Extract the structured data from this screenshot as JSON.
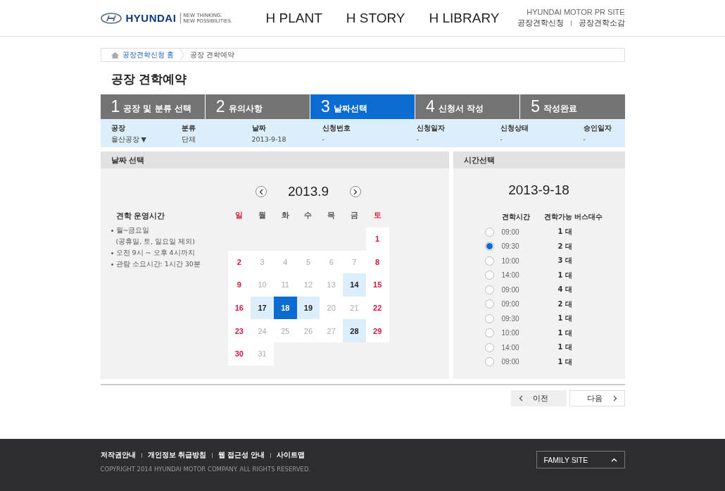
{
  "header": {
    "brand": "HYUNDAI",
    "tagline": [
      "NEW THINKING.",
      "NEW POSSIBILITIES."
    ],
    "nav": [
      "H PLANT",
      "H STORY",
      "H LIBRARY"
    ],
    "site_title": "HYUNDAI MOTOR PR SITE",
    "site_links": [
      "공장견학신청",
      "공장견학소감"
    ]
  },
  "breadcrumb": [
    "공장견학신청 홈",
    "공장 견학예약"
  ],
  "page_title": "공장 견학예약",
  "steps": [
    {
      "number": "1",
      "label": "공장 및 분류 선택",
      "selected": false
    },
    {
      "number": "2",
      "label": "유의사항",
      "selected": false
    },
    {
      "number": "3",
      "label": "날짜선택",
      "selected": true
    },
    {
      "number": "4",
      "label": "신청서 작성",
      "selected": false
    },
    {
      "number": "5",
      "label": "작성완료",
      "selected": false
    }
  ],
  "info": [
    {
      "label": "공장",
      "value": "울산공장 ▼"
    },
    {
      "label": "분류",
      "value": "단체"
    },
    {
      "label": "날짜",
      "value": "2013-9-18"
    },
    {
      "label": "신청번호",
      "value": "-"
    },
    {
      "label": "신청일자",
      "value": "-"
    },
    {
      "label": "신청상태",
      "value": "-"
    },
    {
      "label": "승인일자",
      "value": "-"
    }
  ],
  "date_panel": {
    "title": "날짜 선택",
    "month": "2013.9",
    "hours_title": "견학 운영시간",
    "hours_notes": [
      "월~금요일\n(공휴일, 토, 일요일 제외)",
      "오전 9시 ~ 오후 4시까지",
      "관람 소요시간: 1시간 30분"
    ],
    "weekdays": [
      {
        "label": "일",
        "kind": "weekend"
      },
      {
        "label": "월",
        "kind": "weekday"
      },
      {
        "label": "화",
        "kind": "weekday"
      },
      {
        "label": "수",
        "kind": "weekday"
      },
      {
        "label": "목",
        "kind": "weekday"
      },
      {
        "label": "금",
        "kind": "weekday"
      },
      {
        "label": "토",
        "kind": "weekend"
      }
    ],
    "weeks": [
      [
        {
          "day": "1",
          "kind": "weekend",
          "selected": false
        }
      ],
      [
        {
          "day": "2",
          "kind": "weekend",
          "selected": false
        },
        {
          "day": "3",
          "kind": "closed",
          "selected": false
        },
        {
          "day": "4",
          "kind": "closed",
          "selected": false
        },
        {
          "day": "5",
          "kind": "closed",
          "selected": false
        },
        {
          "day": "6",
          "kind": "closed",
          "selected": false
        },
        {
          "day": "7",
          "kind": "closed",
          "selected": false
        },
        {
          "day": "8",
          "kind": "weekend",
          "selected": false
        }
      ],
      [
        {
          "day": "9",
          "kind": "weekend",
          "selected": false
        },
        {
          "day": "10",
          "kind": "closed",
          "selected": false
        },
        {
          "day": "11",
          "kind": "closed",
          "selected": false
        },
        {
          "day": "12",
          "kind": "closed",
          "selected": false
        },
        {
          "day": "13",
          "kind": "closed",
          "selected": false
        },
        {
          "day": "14",
          "kind": "open",
          "selected": false
        },
        {
          "day": "15",
          "kind": "weekend",
          "selected": false
        }
      ],
      [
        {
          "day": "16",
          "kind": "weekend",
          "selected": false
        },
        {
          "day": "17",
          "kind": "open",
          "selected": false
        },
        {
          "day": "18",
          "kind": "open",
          "selected": true
        },
        {
          "day": "19",
          "kind": "open",
          "selected": false
        },
        {
          "day": "20",
          "kind": "closed",
          "selected": false
        },
        {
          "day": "21",
          "kind": "closed",
          "selected": false
        },
        {
          "day": "22",
          "kind": "weekend",
          "selected": false
        }
      ],
      [
        {
          "day": "23",
          "kind": "weekend",
          "selected": false
        },
        {
          "day": "24",
          "kind": "closed",
          "selected": false
        },
        {
          "day": "25",
          "kind": "closed",
          "selected": false
        },
        {
          "day": "26",
          "kind": "closed",
          "selected": false
        },
        {
          "day": "27",
          "kind": "closed",
          "selected": false
        },
        {
          "day": "28",
          "kind": "open",
          "selected": false
        },
        {
          "day": "29",
          "kind": "weekend",
          "selected": false
        }
      ],
      [
        {
          "day": "30",
          "kind": "weekend",
          "selected": false
        },
        {
          "day": "31",
          "kind": "closed",
          "selected": false
        }
      ]
    ]
  },
  "time_panel": {
    "title": "시간선택",
    "date": "2013-9-18",
    "columns": [
      "견학시간",
      "견학가능 버스대수"
    ],
    "slots": [
      {
        "time": "09:00",
        "buses": "1 대",
        "selected": false
      },
      {
        "time": "09:30",
        "buses": "2 대",
        "selected": true
      },
      {
        "time": "10:00",
        "buses": "3 대",
        "selected": false
      },
      {
        "time": "14:00",
        "buses": "1 대",
        "selected": false
      },
      {
        "time": "09:00",
        "buses": "4 대",
        "selected": false
      },
      {
        "time": "09:00",
        "buses": "2 대",
        "selected": false
      },
      {
        "time": "09:30",
        "buses": "1 대",
        "selected": false
      },
      {
        "time": "10:00",
        "buses": "1 대",
        "selected": false
      },
      {
        "time": "14:00",
        "buses": "1 대",
        "selected": false
      },
      {
        "time": "09:00",
        "buses": "1 대",
        "selected": false
      }
    ]
  },
  "buttons": {
    "prev": "이전",
    "next": "다음"
  },
  "footer": {
    "links": [
      "저작권안내",
      "개인정보 취급방침",
      "웹 접근성 안내",
      "사이트맵"
    ],
    "copyright": "COPYRIGHT 2014 HYUNDAI MOTOR COMPANY. ALL RIGHTS RESERVED.",
    "family_site": "FAMILY SITE"
  }
}
